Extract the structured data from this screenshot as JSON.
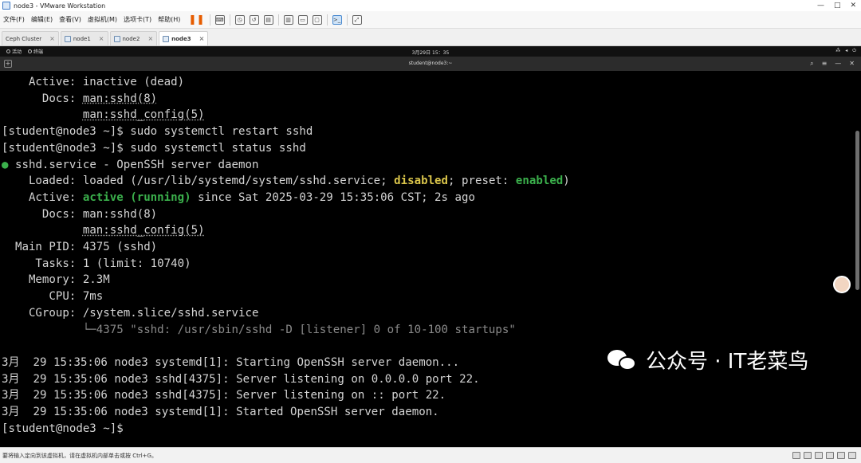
{
  "window": {
    "title": "node3 - VMware Workstation",
    "controls": [
      "—",
      "□",
      "✕"
    ]
  },
  "menu": [
    "文件(F)",
    "编辑(E)",
    "查看(V)",
    "虚拟机(M)",
    "选项卡(T)",
    "帮助(H)"
  ],
  "tabs": [
    {
      "label": "Ceph Cluster",
      "active": false
    },
    {
      "label": "node1",
      "active": false
    },
    {
      "label": "node2",
      "active": false
    },
    {
      "label": "node3",
      "active": true
    }
  ],
  "gnome": {
    "activities": "活动",
    "terminal_app": "终端",
    "clock": "3月29日 15：35"
  },
  "terminal": {
    "title": "student@node3:~",
    "lines": [
      {
        "segs": [
          {
            "t": "    Active: inactive (dead)"
          }
        ]
      },
      {
        "segs": [
          {
            "t": "      Docs: "
          },
          {
            "t": "man:sshd(8)",
            "c": "ul"
          }
        ]
      },
      {
        "segs": [
          {
            "t": "            "
          },
          {
            "t": "man:sshd_config(5)",
            "c": "ul"
          }
        ]
      },
      {
        "segs": [
          {
            "t": "[student@node3 ~]$ sudo systemctl restart sshd"
          }
        ]
      },
      {
        "segs": [
          {
            "t": "[student@node3 ~]$ sudo systemctl status sshd"
          }
        ]
      },
      {
        "segs": [
          {
            "t": "●",
            "c": "g"
          },
          {
            "t": " sshd.service - OpenSSH server daemon"
          }
        ]
      },
      {
        "segs": [
          {
            "t": "    Loaded: loaded (/usr/lib/systemd/system/sshd.service; "
          },
          {
            "t": "disabled",
            "c": "y"
          },
          {
            "t": "; preset: "
          },
          {
            "t": "enabled",
            "c": "g"
          },
          {
            "t": ")"
          }
        ]
      },
      {
        "segs": [
          {
            "t": "    Active: "
          },
          {
            "t": "active (running)",
            "c": "g"
          },
          {
            "t": " since Sat 2025-03-29 15:35:06 CST; 2s ago"
          }
        ]
      },
      {
        "segs": [
          {
            "t": "      Docs: man:sshd(8)"
          }
        ]
      },
      {
        "segs": [
          {
            "t": "            "
          },
          {
            "t": "man:sshd_config(5)",
            "c": "ul"
          }
        ]
      },
      {
        "segs": [
          {
            "t": "  Main PID: 4375 (sshd)"
          }
        ]
      },
      {
        "segs": [
          {
            "t": "     Tasks: 1 (limit: 10740)"
          }
        ]
      },
      {
        "segs": [
          {
            "t": "    Memory: 2.3M"
          }
        ]
      },
      {
        "segs": [
          {
            "t": "       CPU: 7ms"
          }
        ]
      },
      {
        "segs": [
          {
            "t": "    CGroup: /system.slice/sshd.service"
          }
        ]
      },
      {
        "segs": [
          {
            "t": "            └─4375 \"sshd: /usr/sbin/sshd -D [listener] 0 of 10-100 startups\"",
            "c": "dim"
          }
        ]
      },
      {
        "segs": [
          {
            "t": ""
          }
        ]
      },
      {
        "segs": [
          {
            "t": "3月  29 15:35:06 node3 systemd[1]: Starting OpenSSH server daemon..."
          }
        ]
      },
      {
        "segs": [
          {
            "t": "3月  29 15:35:06 node3 sshd[4375]: Server listening on 0.0.0.0 port 22."
          }
        ]
      },
      {
        "segs": [
          {
            "t": "3月  29 15:35:06 node3 sshd[4375]: Server listening on :: port 22."
          }
        ]
      },
      {
        "segs": [
          {
            "t": "3月  29 15:35:06 node3 systemd[1]: Started OpenSSH server daemon."
          }
        ]
      },
      {
        "segs": [
          {
            "t": "[student@node3 ~]$"
          }
        ]
      }
    ]
  },
  "watermark": "公众号 · IT老菜鸟",
  "statusbar": "要将输入定向到该虚拟机，请在虚拟机内部单击或按 Ctrl+G。"
}
